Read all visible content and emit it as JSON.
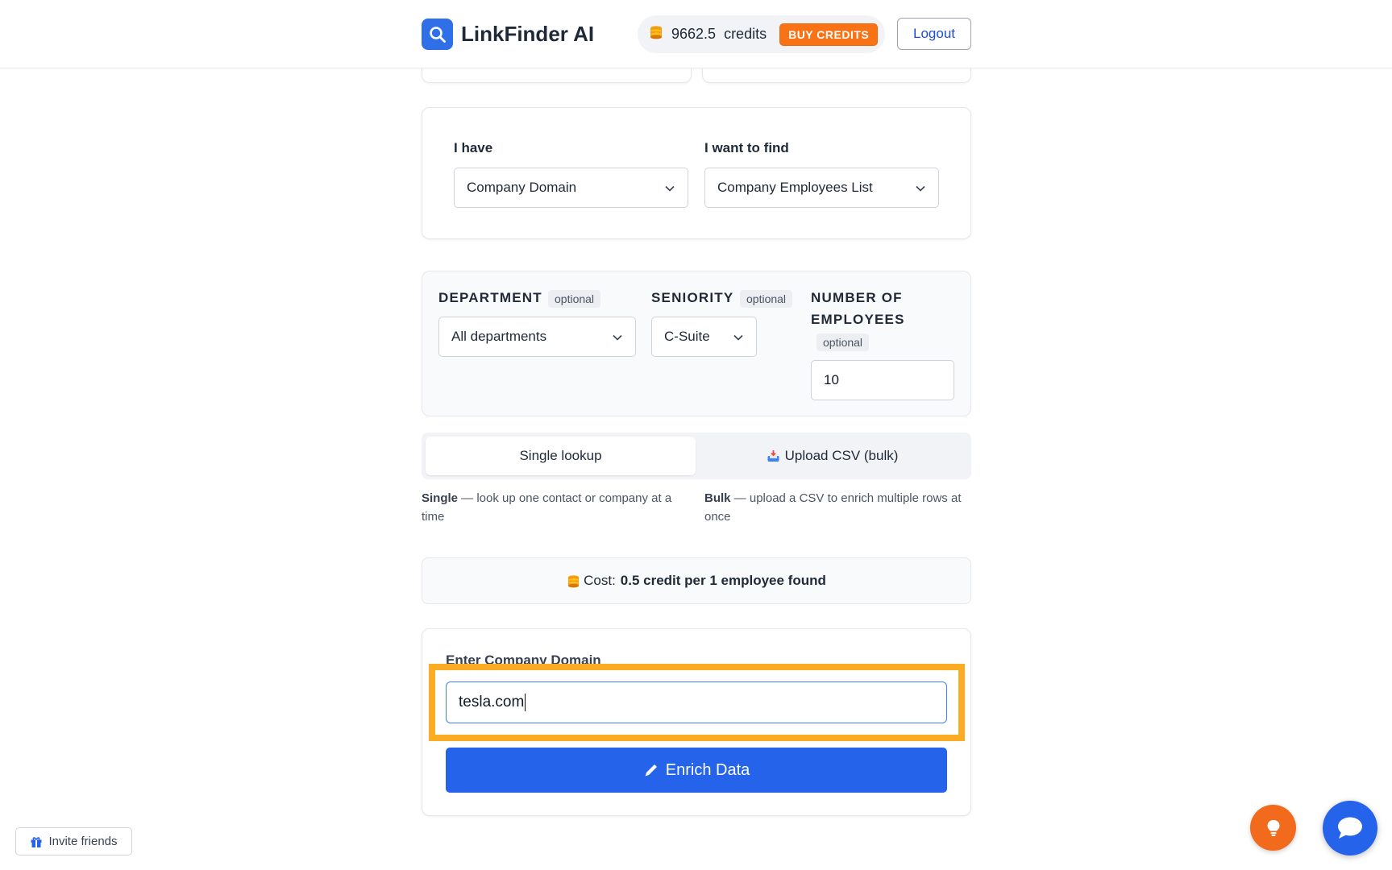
{
  "header": {
    "brand_name": "LinkFinder AI",
    "credits_amount": "9662.5",
    "credits_label": "credits",
    "buy_credits_label": "BUY CREDITS",
    "logout_label": "Logout"
  },
  "lookup_type": {
    "have_label": "I have",
    "have_value": "Company Domain",
    "find_label": "I want to find",
    "find_value": "Company Employees List"
  },
  "filters": {
    "department_label": "DEPARTMENT",
    "department_optional": "optional",
    "department_value": "All departments",
    "seniority_label": "SENIORITY",
    "seniority_optional": "optional",
    "seniority_value": "C-Suite",
    "employees_label_line1": "NUMBER OF",
    "employees_label_line2": "EMPLOYEES",
    "employees_optional": "optional",
    "employees_value": "10"
  },
  "mode": {
    "single_tab": "Single lookup",
    "bulk_tab": "Upload CSV (bulk)",
    "single_hint_bold": "Single",
    "single_hint_text": " — look up one contact or company at a time",
    "bulk_hint_bold": "Bulk",
    "bulk_hint_text": " — upload a CSV to enrich multiple rows at once"
  },
  "cost": {
    "prefix": "Cost:",
    "value": "0.5 credit per 1 employee found"
  },
  "domain": {
    "label": "Enter Company Domain",
    "value": "tesla.com"
  },
  "actions": {
    "enrich_label": "Enrich Data",
    "invite_label": "Invite friends"
  },
  "colors": {
    "primary": "#2563eb",
    "accent_orange": "#f97316",
    "highlight": "#fbab24"
  },
  "icons": [
    "search-icon",
    "coins-icon",
    "chevron-down-icon",
    "inbox-tray-icon",
    "pencil-icon",
    "gift-icon",
    "lightbulb-icon",
    "chat-bubble-icon"
  ]
}
